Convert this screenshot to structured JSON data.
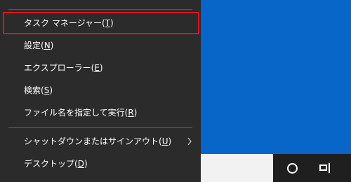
{
  "menu": {
    "items": [
      {
        "label": "タスク マネージャー(",
        "key": "T",
        "close": ")",
        "highlighted": true
      },
      {
        "label": "設定(",
        "key": "N",
        "close": ")"
      },
      {
        "label": "エクスプローラー(",
        "key": "E",
        "close": ")"
      },
      {
        "label": "検索(",
        "key": "S",
        "close": ")"
      },
      {
        "label": "ファイル名を指定して実行(",
        "key": "R",
        "close": ")"
      },
      {
        "label": "シャットダウンまたはサインアウト(",
        "key": "U",
        "close": ")",
        "submenu": true,
        "submenu_icon": "chevron-right-icon"
      },
      {
        "label": "デスクトップ(",
        "key": "D",
        "close": ")"
      }
    ]
  },
  "taskbar": {
    "cortana_icon": "cortana-ring-icon",
    "task_view_icon": "task-view-icon"
  },
  "colors": {
    "menu_bg": "#2b2b2b",
    "highlight_border": "#e0131d",
    "desktop": "#0766c8",
    "taskbar": "#1f1f1f"
  }
}
